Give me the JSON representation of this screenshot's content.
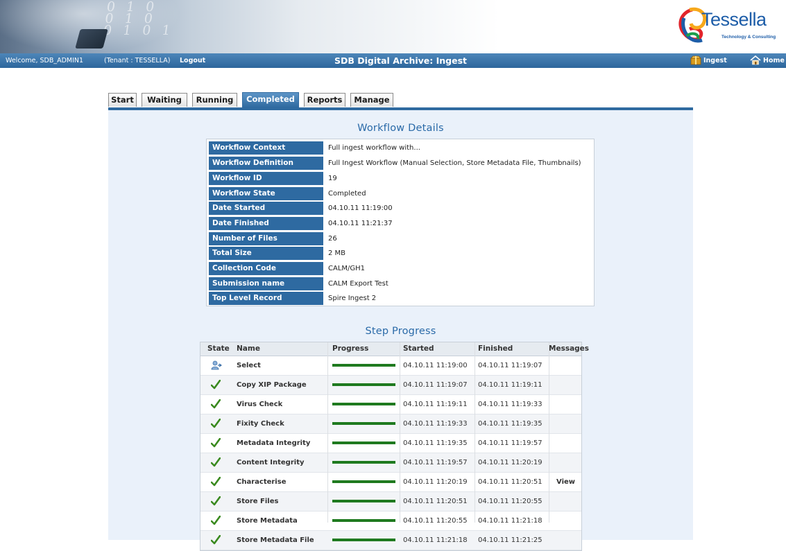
{
  "brand": {
    "name": "Tessella",
    "tagline": "Technology & Consulting",
    "banner_digits": "0 1 0\n0 1 0\n0 1 0 1"
  },
  "nav": {
    "welcome": "Welcome, SDB_ADMIN1",
    "tenant": "(Tenant : TESSELLA)",
    "logout": "Logout",
    "title": "SDB Digital Archive: Ingest",
    "ingest": "Ingest",
    "home": "Home"
  },
  "tabs": [
    {
      "label": "Start"
    },
    {
      "label": "Waiting"
    },
    {
      "label": "Running"
    },
    {
      "label": "Completed",
      "active": true
    },
    {
      "label": "Reports"
    },
    {
      "label": "Manage"
    }
  ],
  "details": {
    "title": "Workflow Details",
    "rows": [
      {
        "key": "Workflow Context",
        "value": "Full ingest workflow with..."
      },
      {
        "key": "Workflow Definition",
        "value": "Full Ingest Workflow (Manual Selection, Store Metadata File, Thumbnails)"
      },
      {
        "key": "Workflow ID",
        "value": "19"
      },
      {
        "key": "Workflow State",
        "value": "Completed"
      },
      {
        "key": "Date Started",
        "value": "04.10.11 11:19:00"
      },
      {
        "key": "Date Finished",
        "value": "04.10.11 11:21:37"
      },
      {
        "key": "Number of Files",
        "value": "26"
      },
      {
        "key": "Total Size",
        "value": "2 MB"
      },
      {
        "key": "Collection Code",
        "value": "CALM/GH1"
      },
      {
        "key": "Submission name",
        "value": "CALM Export Test"
      },
      {
        "key": "Top Level Record",
        "value": "Spire Ingest 2"
      }
    ]
  },
  "steps": {
    "title": "Step Progress",
    "columns": [
      "State",
      "Name",
      "Progress",
      "Started",
      "Finished",
      "Messages"
    ],
    "rows": [
      {
        "state_icon": "user-icon",
        "name": "Select",
        "progress": 1.0,
        "started": "04.10.11 11:19:00",
        "finished": "04.10.11 11:19:07",
        "messages": ""
      },
      {
        "state_icon": "check-icon",
        "name": "Copy XIP Package",
        "progress": 1.0,
        "started": "04.10.11 11:19:07",
        "finished": "04.10.11 11:19:11",
        "messages": ""
      },
      {
        "state_icon": "check-icon",
        "name": "Virus Check",
        "progress": 1.0,
        "started": "04.10.11 11:19:11",
        "finished": "04.10.11 11:19:33",
        "messages": ""
      },
      {
        "state_icon": "check-icon",
        "name": "Fixity Check",
        "progress": 1.0,
        "started": "04.10.11 11:19:33",
        "finished": "04.10.11 11:19:35",
        "messages": ""
      },
      {
        "state_icon": "check-icon",
        "name": "Metadata Integrity",
        "progress": 1.0,
        "started": "04.10.11 11:19:35",
        "finished": "04.10.11 11:19:57",
        "messages": ""
      },
      {
        "state_icon": "check-icon",
        "name": "Content Integrity",
        "progress": 1.0,
        "started": "04.10.11 11:19:57",
        "finished": "04.10.11 11:20:19",
        "messages": ""
      },
      {
        "state_icon": "check-icon",
        "name": "Characterise",
        "progress": 1.0,
        "started": "04.10.11 11:20:19",
        "finished": "04.10.11 11:20:51",
        "messages": "View"
      },
      {
        "state_icon": "check-icon",
        "name": "Store Files",
        "progress": 1.0,
        "started": "04.10.11 11:20:51",
        "finished": "04.10.11 11:20:55",
        "messages": ""
      },
      {
        "state_icon": "check-icon",
        "name": "Store Metadata",
        "progress": 1.0,
        "started": "04.10.11 11:20:55",
        "finished": "04.10.11 11:21:18",
        "messages": ""
      },
      {
        "state_icon": "check-icon",
        "name": "Store Metadata File",
        "progress": 1.0,
        "started": "04.10.11 11:21:18",
        "finished": "04.10.11 11:21:25",
        "messages": ""
      }
    ]
  },
  "colors": {
    "accent": "#2e6aa1",
    "panel": "#eaf1fa",
    "progress": "#1f7a1f",
    "check": "#3a8a1f"
  }
}
